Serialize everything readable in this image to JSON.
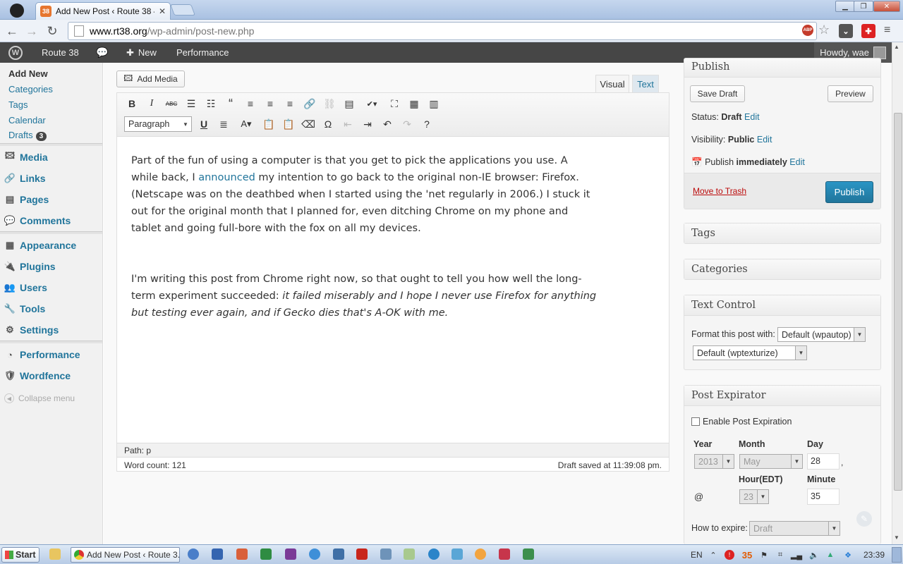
{
  "browser": {
    "tab_title": "Add New Post ‹ Route 38 —",
    "tab_favicon_text": "38",
    "url_host": "www.rt38.org",
    "url_path": "/wp-admin/post-new.php",
    "ext_abp": "ABP"
  },
  "adminbar": {
    "site_name": "Route 38",
    "new_label": "New",
    "performance_label": "Performance",
    "howdy": "Howdy, wae"
  },
  "sidebar": {
    "posts_sub": [
      "Add New",
      "Categories",
      "Tags",
      "Calendar",
      "Drafts"
    ],
    "drafts_count": "3",
    "menu1": [
      {
        "label": "Media",
        "icon": "🖾"
      },
      {
        "label": "Links",
        "icon": "🔗"
      },
      {
        "label": "Pages",
        "icon": "▤"
      },
      {
        "label": "Comments",
        "icon": "💬"
      }
    ],
    "menu2": [
      {
        "label": "Appearance",
        "icon": "▦"
      },
      {
        "label": "Plugins",
        "icon": "🔌"
      },
      {
        "label": "Users",
        "icon": "👥"
      },
      {
        "label": "Tools",
        "icon": "🔧"
      },
      {
        "label": "Settings",
        "icon": "⚙"
      }
    ],
    "menu3": [
      {
        "label": "Performance",
        "icon": "◔"
      },
      {
        "label": "Wordfence",
        "icon": "🛡"
      }
    ],
    "collapse": "Collapse menu"
  },
  "editor": {
    "add_media": "Add Media",
    "tab_visual": "Visual",
    "tab_text": "Text",
    "format_select": "Paragraph",
    "p1_a": "Part of the fun of using a computer is that you get to pick the applications you use.  A while back, I ",
    "p1_link": "announced",
    "p1_b": " my intention to go back to the original non-IE browser: Firefox.  (Netscape was on the deathbed when I started using the 'net regularly in 2006.)  I stuck it out for the original month that I planned for, even ditching Chrome on my phone and tablet and going full-bore with the fox on all my devices.",
    "p2_a": "I'm writing this post from Chrome right now, so that ought to tell you how well the long-term experiment succeeded: ",
    "p2_em": "it failed miserably and I hope I never use Firefox for anything but testing ever again, and if Gecko dies that's A-OK with me.",
    "path": "Path: p",
    "word_count": "Word count: 121",
    "draft_saved": "Draft saved at 11:39:08 pm."
  },
  "publish": {
    "title": "Publish",
    "save_draft": "Save Draft",
    "preview": "Preview",
    "status_label": "Status: ",
    "status_value": "Draft",
    "visibility_label": "Visibility: ",
    "visibility_value": "Public",
    "publish_label": "Publish ",
    "publish_value": "immediately",
    "edit": "Edit",
    "move_trash": "Move to Trash",
    "publish_btn": "Publish"
  },
  "tags_title": "Tags",
  "categories_title": "Categories",
  "text_control": {
    "title": "Text Control",
    "format_label": "Format this post with:",
    "format_value": "Default (wpautop)",
    "texturize_value": "Default (wptexturize)"
  },
  "expirator": {
    "title": "Post Expirator",
    "enable_label": "Enable Post Expiration",
    "year_label": "Year",
    "month_label": "Month",
    "day_label": "Day",
    "year_value": "2013",
    "month_value": "May",
    "day_value": "28",
    "comma": ",",
    "hour_label": "Hour(EDT)",
    "minute_label": "Minute",
    "at": "@",
    "hour_value": "23",
    "minute_value": "35",
    "how_label": "How to expire:",
    "how_value": "Draft"
  },
  "taskbar": {
    "start": "Start",
    "task_title": "Add New Post ‹ Route 3...",
    "lang": "EN",
    "tray_num": "35",
    "clock": "23:39"
  }
}
